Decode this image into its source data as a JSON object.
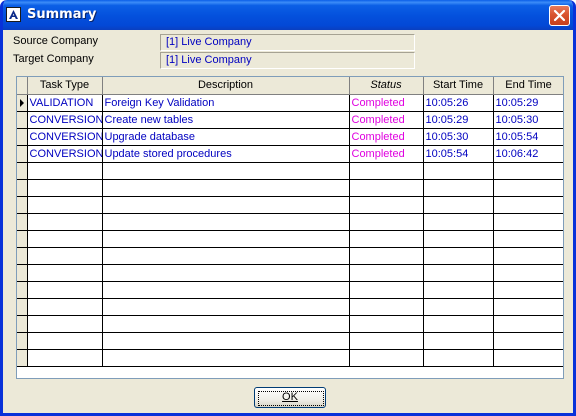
{
  "window": {
    "title": "Summary",
    "title_icon": "app-a-icon",
    "close_icon": "close-icon"
  },
  "info": {
    "source_label": "Source Company",
    "source_value": "[1] Live Company",
    "target_label": "Target Company",
    "target_value": "[1] Live Company"
  },
  "grid": {
    "columns": [
      "Task Type",
      "Description",
      "Status",
      "Start Time",
      "End Time"
    ],
    "rows": [
      {
        "task_type": "VALIDATION",
        "description": "Foreign Key Validation",
        "status": "Completed",
        "start": "10:05:26",
        "end": "10:05:29"
      },
      {
        "task_type": "CONVERSION",
        "description": "Create new tables",
        "status": "Completed",
        "start": "10:05:29",
        "end": "10:05:30"
      },
      {
        "task_type": "CONVERSION",
        "description": "Upgrade database",
        "status": "Completed",
        "start": "10:05:30",
        "end": "10:05:54"
      },
      {
        "task_type": "CONVERSION",
        "description": "Update stored procedures",
        "status": "Completed",
        "start": "10:05:54",
        "end": "10:06:42"
      }
    ],
    "empty_rows": 12,
    "colors": {
      "text": "#0000c0",
      "status": "#e000e0",
      "grid_line": "#000000"
    }
  },
  "buttons": {
    "ok_label": "OK"
  }
}
